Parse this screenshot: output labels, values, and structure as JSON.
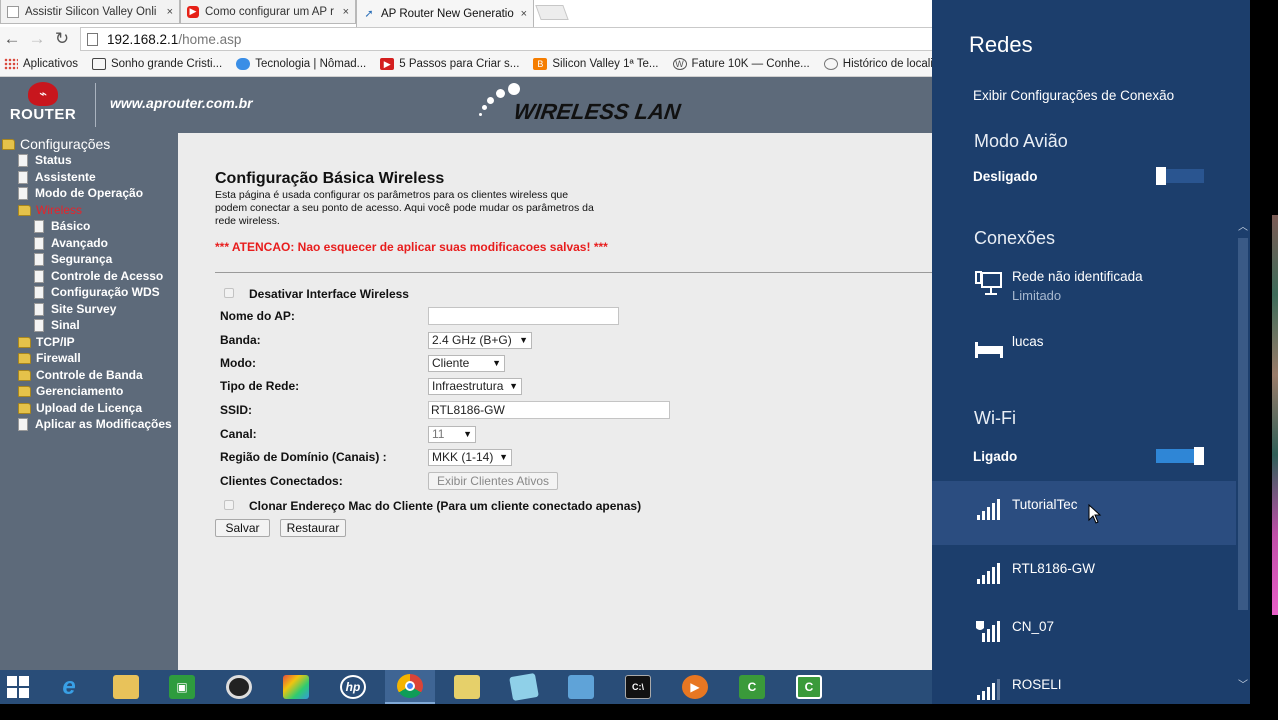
{
  "browser": {
    "tabs": [
      {
        "title": "Assistir Silicon Valley Onli",
        "favicon": "page-icon",
        "color": "#9a9a9a"
      },
      {
        "title": "Como configurar um AP r",
        "favicon": "youtube-icon",
        "color": "#e62117"
      },
      {
        "title": "AP Router New Generatio",
        "favicon": "wifi-icon",
        "color": "#2b6fb8"
      }
    ],
    "close_glyph": "×",
    "url_host": "192.168.2.1",
    "url_path": "/home.asp",
    "bookmarks": [
      {
        "label": "Aplicativos",
        "icon": "apps-grid-icon",
        "color": "#d94a3d"
      },
      {
        "label": "Sonho grande Cristi...",
        "icon": "inbox-icon",
        "color": "#555555"
      },
      {
        "label": "Tecnologia | Nômad...",
        "icon": "cloud-icon",
        "color": "#3a8ee6"
      },
      {
        "label": "5 Passos para Criar s...",
        "icon": "youtube-icon",
        "color": "#d41f1f"
      },
      {
        "label": "Silicon Valley 1ª Te...",
        "icon": "blogger-icon",
        "color": "#f57d00"
      },
      {
        "label": "Fature 10K — Conhe...",
        "icon": "wordpress-icon",
        "color": "#555555"
      },
      {
        "label": "Histórico de localiza...",
        "icon": "globe-icon",
        "color": "#777777"
      }
    ]
  },
  "router": {
    "logo_text": "ROUTER",
    "site_url": "www.aprouter.com.br",
    "wlan_title": "WIRELESS LAN",
    "nav": {
      "root": "Configurações",
      "items": [
        {
          "label": "Status",
          "type": "doc",
          "level": 1
        },
        {
          "label": "Assistente",
          "type": "doc",
          "level": 1
        },
        {
          "label": "Modo de Operação",
          "type": "doc",
          "level": 1
        },
        {
          "label": "Wireless",
          "type": "folder",
          "level": 1,
          "selected": true
        },
        {
          "label": "Básico",
          "type": "doc",
          "level": 2
        },
        {
          "label": "Avançado",
          "type": "doc",
          "level": 2
        },
        {
          "label": "Segurança",
          "type": "doc",
          "level": 2
        },
        {
          "label": "Controle de Acesso",
          "type": "doc",
          "level": 2
        },
        {
          "label": "Configuração WDS",
          "type": "doc",
          "level": 2
        },
        {
          "label": "Site Survey",
          "type": "doc",
          "level": 2
        },
        {
          "label": "Sinal",
          "type": "doc",
          "level": 2
        },
        {
          "label": "TCP/IP",
          "type": "folder",
          "level": 1
        },
        {
          "label": "Firewall",
          "type": "folder",
          "level": 1
        },
        {
          "label": "Controle de Banda",
          "type": "folder",
          "level": 1
        },
        {
          "label": "Gerenciamento",
          "type": "folder",
          "level": 1
        },
        {
          "label": "Upload de Licença",
          "type": "folder",
          "level": 1
        },
        {
          "label": "Aplicar as Modificações",
          "type": "doc",
          "level": 1
        }
      ]
    },
    "page": {
      "title": "Configuração Básica Wireless",
      "description": "Esta página é usada configurar os parâmetros para os clientes wireless que podem conectar a seu ponto de acesso. Aqui você pode mudar os parâmetros da rede wireless.",
      "warning": "*** ATENCAO: Nao esquecer de aplicar suas modificacoes salvas! ***",
      "disable_wireless_label": "Desativar Interface Wireless",
      "disable_wireless_checked": false,
      "fields": {
        "ap_name_label": "Nome do AP:",
        "ap_name_value": "",
        "band_label": "Banda:",
        "band_value": "2.4 GHz (B+G)",
        "mode_label": "Modo:",
        "mode_value": "Cliente",
        "network_type_label": "Tipo de Rede:",
        "network_type_value": "Infraestrutura",
        "ssid_label": "SSID:",
        "ssid_value": "RTL8186-GW",
        "channel_label": "Canal:",
        "channel_value": "11",
        "domain_label": "Região de Domínio (Canais) :",
        "domain_value": "MKK (1-14)",
        "clients_label": "Clientes Conectados:",
        "clients_button": "Exibir Clientes Ativos"
      },
      "clone_mac_label": "Clonar Endereço Mac do Cliente (Para um cliente conectado apenas)",
      "clone_mac_checked": false,
      "save_button": "Salvar",
      "reset_button": "Restaurar"
    }
  },
  "taskbar": {
    "items": [
      {
        "name": "windows-start-icon",
        "color": "#ffffff"
      },
      {
        "name": "internet-explorer-icon",
        "color": "#1e90d8"
      },
      {
        "name": "file-explorer-icon",
        "color": "#e8c25a"
      },
      {
        "name": "store-icon",
        "color": "#2e9c3e"
      },
      {
        "name": "webcam-icon",
        "color": "#222222"
      },
      {
        "name": "photos-icon",
        "color": "#c0392b"
      },
      {
        "name": "hp-icon",
        "color": "#1a6fb5",
        "glyph": "hp"
      },
      {
        "name": "chrome-icon",
        "color": "#db4437",
        "active": true
      },
      {
        "name": "folder-icon",
        "color": "#e6d06a"
      },
      {
        "name": "notes-icon",
        "color": "#8fd0e8"
      },
      {
        "name": "control-panel-icon",
        "color": "#5fa3d8"
      },
      {
        "name": "command-prompt-icon",
        "color": "#111111"
      },
      {
        "name": "media-player-icon",
        "color": "#e87722"
      },
      {
        "name": "camtasia-icon",
        "color": "#3a9a3a"
      },
      {
        "name": "camtasia-recorder-icon",
        "color": "#3a9a3a"
      }
    ]
  },
  "networks_charm": {
    "title": "Redes",
    "view_settings_link": "Exibir Configurações de Conexão",
    "airplane": {
      "heading": "Modo Avião",
      "state": "Desligado",
      "on": false
    },
    "connections": {
      "heading": "Conexões",
      "items": [
        {
          "name": "Rede não identificada",
          "status": "Limitado",
          "icon": "wired-network-icon"
        },
        {
          "name": "lucas",
          "status": "",
          "icon": "bed-network-icon"
        }
      ]
    },
    "wifi": {
      "heading": "Wi-Fi",
      "state": "Ligado",
      "on": true,
      "networks": [
        {
          "name": "TutorialTec",
          "icon": "wifi-signal-icon",
          "hover": true
        },
        {
          "name": "RTL8186-GW",
          "icon": "wifi-signal-icon",
          "hover": false
        },
        {
          "name": "CN_07",
          "icon": "wifi-secured-icon",
          "hover": false
        },
        {
          "name": "ROSELI",
          "icon": "wifi-signal-icon",
          "hover": false
        }
      ]
    },
    "colors": {
      "background": "#1c3e6c",
      "accent": "#2f86d6"
    }
  }
}
